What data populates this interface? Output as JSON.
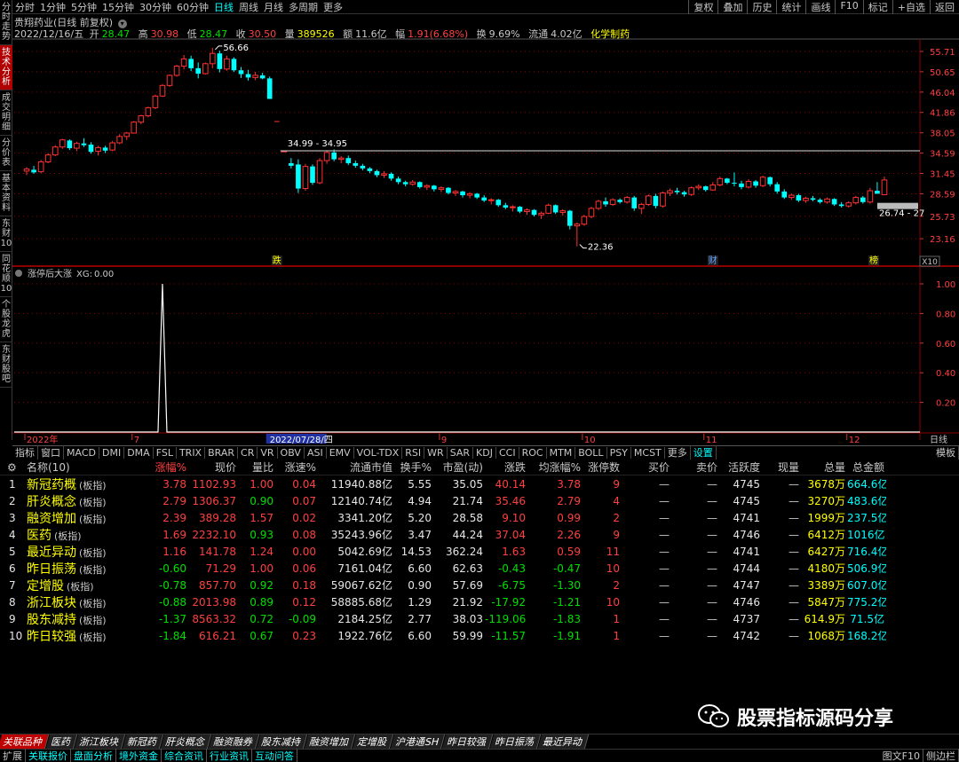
{
  "left_tabs": [
    "分时走势",
    "技术分析",
    "成交明细",
    "分价表",
    "基本资料",
    "东财10",
    "同花顺10",
    "个股龙虎",
    "东财股吧"
  ],
  "timeframes": [
    "分时",
    "1分钟",
    "5分钟",
    "15分钟",
    "30分钟",
    "60分钟",
    "日线",
    "周线",
    "月线",
    "多周期",
    "更多"
  ],
  "active_timeframe": "日线",
  "toolbar_right": [
    "复权",
    "叠加",
    "历史",
    "统计",
    "画线",
    "F10",
    "标记",
    "+自选",
    "返回"
  ],
  "stock": {
    "title": "贵翔药业(日线 前复权)"
  },
  "ohlc": {
    "date": "2022/12/16/五",
    "open_label": "开",
    "open": "28.47",
    "high_label": "高",
    "high": "30.98",
    "low_label": "低",
    "low": "28.47",
    "close_label": "收",
    "close": "30.50",
    "vol_label": "量",
    "vol": "389526",
    "amount_label": "额",
    "amount": "11.6亿",
    "change_label": "幅",
    "change": "1.91(6.68%)",
    "turnover_label": "换",
    "turnover": "9.69%",
    "float_label": "流通",
    "float": "4.02亿",
    "industry": "化学制药"
  },
  "price_axis": [
    "55.71",
    "50.65",
    "46.04",
    "41.86",
    "38.05",
    "34.59",
    "31.45",
    "28.59",
    "25.73",
    "23.16"
  ],
  "price_range": [
    21.5,
    58.8
  ],
  "annotations": {
    "high": "56.66",
    "low": "22.36",
    "band": "34.99 - 34.95",
    "right_band": "26.74 - 27"
  },
  "markers": [
    "跌",
    "财",
    "榜"
  ],
  "zoom_label": "X10",
  "candles": [
    [
      31.8,
      32.4,
      31.2,
      32.1
    ],
    [
      32.0,
      32.6,
      31.4,
      31.6
    ],
    [
      31.7,
      33.5,
      31.5,
      33.2
    ],
    [
      33.2,
      34.6,
      33.0,
      34.3
    ],
    [
      34.3,
      35.9,
      34.1,
      35.6
    ],
    [
      35.6,
      37.0,
      35.3,
      36.8
    ],
    [
      36.7,
      36.9,
      35.1,
      35.4
    ],
    [
      35.4,
      36.5,
      34.9,
      36.2
    ],
    [
      36.2,
      37.1,
      35.6,
      35.9
    ],
    [
      36.0,
      36.4,
      34.5,
      34.8
    ],
    [
      34.9,
      35.8,
      34.2,
      35.5
    ],
    [
      35.5,
      35.8,
      34.6,
      35.0
    ],
    [
      35.1,
      36.6,
      34.9,
      36.3
    ],
    [
      36.3,
      37.8,
      36.1,
      37.4
    ],
    [
      37.4,
      38.2,
      36.8,
      38.0
    ],
    [
      38.0,
      40.2,
      37.9,
      40.0
    ],
    [
      40.0,
      41.4,
      39.6,
      41.2
    ],
    [
      41.2,
      43.0,
      40.9,
      42.8
    ],
    [
      42.8,
      45.5,
      42.5,
      45.2
    ],
    [
      45.2,
      47.8,
      45.0,
      47.5
    ],
    [
      47.5,
      50.0,
      47.2,
      49.8
    ],
    [
      49.8,
      52.3,
      49.5,
      52.0
    ],
    [
      52.0,
      54.8,
      51.2,
      53.8
    ],
    [
      53.8,
      54.6,
      50.8,
      51.5
    ],
    [
      51.5,
      52.9,
      49.1,
      50.2
    ],
    [
      50.2,
      52.9,
      50.0,
      52.6
    ],
    [
      52.6,
      56.66,
      51.5,
      55.2
    ],
    [
      55.2,
      55.9,
      50.5,
      51.3
    ],
    [
      51.3,
      54.6,
      50.9,
      53.8
    ],
    [
      53.8,
      54.2,
      50.6,
      51.0
    ],
    [
      51.0,
      51.8,
      49.2,
      50.1
    ],
    [
      50.1,
      51.1,
      48.6,
      49.3
    ],
    [
      49.3,
      50.6,
      48.7,
      49.8
    ],
    [
      49.8,
      50.4,
      48.9,
      49.1
    ],
    [
      49.1,
      49.5,
      44.6,
      44.6
    ],
    [
      40.2,
      40.2,
      40.2,
      40.2
    ],
    [
      34.9,
      35.0,
      34.9,
      34.95
    ],
    [
      33.0,
      33.8,
      32.2,
      32.6
    ],
    [
      32.8,
      33.6,
      28.7,
      29.3
    ],
    [
      29.3,
      32.9,
      29.0,
      32.5
    ],
    [
      32.5,
      32.8,
      29.8,
      30.1
    ],
    [
      30.1,
      33.8,
      29.9,
      33.4
    ],
    [
      33.4,
      34.9,
      32.9,
      34.7
    ],
    [
      34.7,
      35.2,
      33.3,
      33.6
    ],
    [
      33.6,
      34.1,
      33.0,
      33.8
    ],
    [
      33.8,
      34.2,
      32.7,
      33.0
    ],
    [
      33.0,
      33.4,
      32.3,
      32.6
    ],
    [
      32.6,
      32.9,
      31.9,
      32.2
    ],
    [
      32.2,
      32.4,
      31.5,
      31.8
    ],
    [
      31.8,
      32.0,
      30.9,
      31.2
    ],
    [
      31.2,
      31.8,
      30.8,
      31.4
    ],
    [
      31.4,
      31.6,
      30.4,
      30.7
    ],
    [
      30.7,
      31.0,
      29.9,
      30.2
    ],
    [
      30.2,
      30.4,
      29.6,
      29.9
    ],
    [
      29.9,
      30.5,
      29.7,
      30.2
    ],
    [
      30.2,
      30.3,
      29.3,
      29.5
    ],
    [
      29.5,
      29.9,
      29.1,
      29.7
    ],
    [
      29.7,
      29.8,
      28.9,
      29.2
    ],
    [
      29.2,
      29.6,
      28.8,
      29.4
    ],
    [
      29.4,
      29.5,
      28.5,
      28.7
    ],
    [
      28.7,
      29.1,
      28.3,
      28.9
    ],
    [
      28.9,
      29.0,
      28.1,
      28.4
    ],
    [
      28.4,
      28.8,
      28.0,
      28.6
    ],
    [
      28.6,
      28.7,
      27.9,
      28.1
    ],
    [
      28.1,
      28.4,
      27.5,
      27.7
    ],
    [
      27.7,
      28.0,
      27.2,
      27.8
    ],
    [
      27.8,
      27.9,
      26.9,
      27.1
    ],
    [
      27.1,
      27.4,
      26.6,
      26.8
    ],
    [
      26.8,
      27.1,
      26.3,
      26.9
    ],
    [
      26.9,
      27.0,
      26.1,
      26.3
    ],
    [
      26.3,
      26.7,
      25.9,
      26.5
    ],
    [
      26.5,
      26.6,
      25.7,
      25.9
    ],
    [
      25.9,
      26.3,
      25.4,
      26.1
    ],
    [
      26.1,
      27.3,
      26.0,
      27.1
    ],
    [
      27.1,
      27.2,
      26.0,
      26.2
    ],
    [
      26.2,
      26.6,
      25.8,
      26.4
    ],
    [
      26.4,
      26.5,
      24.2,
      24.6
    ],
    [
      24.6,
      25.0,
      22.36,
      24.8
    ],
    [
      24.8,
      25.9,
      24.6,
      25.7
    ],
    [
      25.7,
      26.9,
      25.5,
      26.7
    ],
    [
      26.7,
      27.8,
      26.5,
      27.6
    ],
    [
      27.6,
      28.1,
      26.9,
      27.2
    ],
    [
      27.2,
      28.0,
      27.0,
      27.8
    ],
    [
      27.8,
      28.0,
      27.3,
      27.5
    ],
    [
      27.5,
      28.3,
      27.3,
      28.1
    ],
    [
      28.1,
      28.3,
      26.4,
      26.7
    ],
    [
      26.7,
      27.4,
      26.0,
      27.2
    ],
    [
      27.2,
      28.5,
      27.0,
      28.3
    ],
    [
      28.3,
      28.6,
      26.7,
      27.0
    ],
    [
      27.0,
      28.9,
      26.8,
      28.7
    ],
    [
      28.7,
      29.3,
      28.3,
      29.0
    ],
    [
      29.0,
      29.4,
      28.5,
      28.8
    ],
    [
      28.8,
      29.0,
      28.2,
      28.5
    ],
    [
      28.5,
      29.6,
      28.3,
      29.4
    ],
    [
      29.4,
      29.9,
      29.1,
      29.6
    ],
    [
      29.6,
      29.7,
      28.9,
      29.1
    ],
    [
      29.1,
      30.2,
      29.0,
      29.8
    ],
    [
      29.8,
      31.0,
      29.6,
      30.7
    ],
    [
      30.7,
      30.8,
      29.9,
      30.1
    ],
    [
      30.1,
      31.6,
      29.6,
      30.0
    ],
    [
      30.0,
      30.4,
      29.2,
      29.5
    ],
    [
      29.5,
      30.6,
      29.3,
      30.3
    ],
    [
      30.3,
      30.5,
      29.4,
      29.7
    ],
    [
      29.7,
      31.1,
      29.5,
      30.9
    ],
    [
      30.9,
      31.0,
      29.6,
      29.9
    ],
    [
      29.9,
      30.2,
      28.6,
      28.9
    ],
    [
      28.9,
      29.2,
      27.9,
      28.1
    ],
    [
      28.1,
      28.6,
      27.8,
      28.4
    ],
    [
      28.4,
      28.6,
      27.5,
      27.7
    ],
    [
      27.7,
      28.2,
      27.4,
      28.0
    ],
    [
      28.0,
      28.3,
      27.6,
      27.8
    ],
    [
      27.8,
      28.0,
      27.3,
      27.5
    ],
    [
      27.5,
      28.1,
      27.3,
      27.9
    ],
    [
      27.9,
      28.0,
      27.0,
      27.2
    ],
    [
      27.2,
      27.5,
      26.8,
      27.0
    ],
    [
      27.0,
      27.6,
      26.8,
      27.4
    ],
    [
      27.4,
      28.3,
      27.2,
      28.1
    ],
    [
      28.1,
      28.3,
      27.3,
      27.5
    ],
    [
      27.5,
      29.4,
      27.3,
      29.0
    ],
    [
      29.0,
      30.2,
      28.6,
      28.59
    ],
    [
      28.47,
      30.98,
      28.47,
      30.5
    ]
  ],
  "lower_panel": {
    "title": "涨停后大涨",
    "xg_label": "XG:",
    "xg_value": "0.00",
    "y_labels": [
      "1.00",
      "0.80",
      "0.60",
      "0.40",
      "0.20"
    ]
  },
  "spike": {
    "index": 19,
    "value": 1.0
  },
  "date_axis": [
    [
      "2022年",
      0
    ],
    [
      "7",
      15
    ],
    [
      "2022/07/28/四",
      34
    ],
    [
      "9",
      58
    ],
    [
      "10",
      78
    ],
    [
      "11",
      95
    ],
    [
      "12",
      115
    ]
  ],
  "date_axis_right": "日线",
  "indicators": [
    "指标",
    "窗口",
    "MACD",
    "DMI",
    "DMA",
    "FSL",
    "TRIX",
    "BRAR",
    "CR",
    "VR",
    "OBV",
    "ASI",
    "EMV",
    "VOL-TDX",
    "RSI",
    "WR",
    "SAR",
    "KDJ",
    "CCI",
    "ROC",
    "MTM",
    "BOLL",
    "PSY",
    "MCST",
    "更多",
    "设置"
  ],
  "indicator_right": "模板",
  "table": {
    "headers": [
      "名称(10)",
      "涨幅%",
      "现价",
      "量比",
      "涨速%",
      "流通市值",
      "换手%",
      "市盈(动)",
      "涨跌",
      "均涨幅%",
      "涨停数",
      "买价",
      "卖价",
      "活跃度",
      "现量",
      "总量",
      "总金额"
    ],
    "tag": "(板指)",
    "rows": [
      [
        "1",
        "新冠药概",
        "3.78",
        "1102.93",
        "1.00",
        "0.04",
        "11940.88亿",
        "5.55",
        "35.05",
        "40.14",
        "3.78",
        "9",
        "—",
        "—",
        "4745",
        "—",
        "3678万",
        "664.6亿"
      ],
      [
        "2",
        "肝炎概念",
        "2.79",
        "1306.37",
        "0.90",
        "0.07",
        "12140.74亿",
        "4.94",
        "21.74",
        "35.46",
        "2.79",
        "4",
        "—",
        "—",
        "4745",
        "—",
        "3270万",
        "483.6亿"
      ],
      [
        "3",
        "融资增加",
        "2.39",
        "389.28",
        "1.57",
        "0.02",
        "3341.20亿",
        "5.20",
        "28.58",
        "9.10",
        "0.99",
        "2",
        "—",
        "—",
        "4741",
        "—",
        "1999万",
        "237.5亿"
      ],
      [
        "4",
        "医药",
        "1.69",
        "2232.10",
        "0.93",
        "0.08",
        "35243.96亿",
        "3.47",
        "44.24",
        "37.04",
        "2.26",
        "9",
        "—",
        "—",
        "4746",
        "—",
        "6412万",
        "1016亿"
      ],
      [
        "5",
        "最近异动",
        "1.16",
        "141.78",
        "1.24",
        "0.00",
        "5042.69亿",
        "14.53",
        "362.24",
        "1.63",
        "0.59",
        "11",
        "—",
        "—",
        "4741",
        "—",
        "6427万",
        "716.4亿"
      ],
      [
        "6",
        "昨日振荡",
        "-0.60",
        "71.29",
        "1.00",
        "0.06",
        "7161.04亿",
        "6.60",
        "62.63",
        "-0.43",
        "-0.47",
        "10",
        "—",
        "—",
        "4744",
        "—",
        "4180万",
        "506.9亿"
      ],
      [
        "7",
        "定增股",
        "-0.78",
        "857.70",
        "0.92",
        "0.18",
        "59067.62亿",
        "0.90",
        "57.69",
        "-6.75",
        "-1.30",
        "2",
        "—",
        "—",
        "4747",
        "—",
        "3389万",
        "607.0亿"
      ],
      [
        "8",
        "浙江板块",
        "-0.88",
        "2013.98",
        "0.89",
        "0.12",
        "58885.68亿",
        "1.29",
        "21.92",
        "-17.92",
        "-1.21",
        "10",
        "—",
        "—",
        "4746",
        "—",
        "5847万",
        "775.2亿"
      ],
      [
        "9",
        "股东减持",
        "-1.37",
        "8563.32",
        "0.72",
        "-0.09",
        "2184.25亿",
        "2.77",
        "38.03",
        "-119.06",
        "-1.83",
        "1",
        "—",
        "—",
        "4737",
        "—",
        "614.9万",
        "71.5亿"
      ],
      [
        "10",
        "昨日较强",
        "-1.84",
        "616.21",
        "0.67",
        "0.23",
        "1922.76亿",
        "6.60",
        "59.99",
        "-11.57",
        "-1.91",
        "1",
        "—",
        "—",
        "4742",
        "—",
        "1068万",
        "168.2亿"
      ]
    ]
  },
  "watermark": "股票指标源码分享",
  "section_tabs": [
    "关联品种",
    "医药",
    "浙江板块",
    "新冠药",
    "肝炎概念",
    "融资融券",
    "股东减持",
    "融资增加",
    "定增股",
    "沪港通SH",
    "昨日较强",
    "昨日振荡",
    "最近异动"
  ],
  "bottom_bar": [
    "扩展",
    "关联报价",
    "盘面分析",
    "境外资金",
    "综合资讯",
    "行业资讯",
    "互动问答"
  ],
  "bottom_right": [
    "图文F10",
    "侧边栏"
  ],
  "colors": {
    "up": "#ff3232",
    "down": "#00ffff",
    "bg": "#000000",
    "grid": "#8b0000"
  }
}
